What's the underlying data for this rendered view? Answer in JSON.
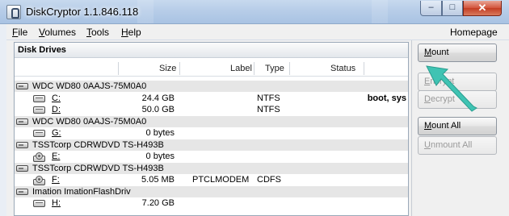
{
  "window": {
    "title": "DiskCryptor 1.1.846.118",
    "minimize_glyph": "–",
    "maximize_glyph": "□",
    "close_glyph": "✕"
  },
  "menu": {
    "file": {
      "u": "F",
      "rest": "ile"
    },
    "volumes": {
      "u": "V",
      "rest": "olumes"
    },
    "tools": {
      "u": "T",
      "rest": "ools"
    },
    "help": {
      "u": "H",
      "rest": "elp"
    },
    "homepage": "Homepage"
  },
  "panel": {
    "title": "Disk Drives",
    "columns": {
      "size": "Size",
      "label": "Label",
      "type": "Type",
      "status": "Status"
    }
  },
  "rows": [
    {
      "kind": "disk",
      "name": "WDC WD80 0AAJS-75M0A0"
    },
    {
      "kind": "volume",
      "letter": "C:",
      "size": "24.4 GB",
      "label": "",
      "type": "NTFS",
      "status": "boot, sys"
    },
    {
      "kind": "volume",
      "letter": "D:",
      "size": "50.0 GB",
      "label": "",
      "type": "NTFS",
      "status": ""
    },
    {
      "kind": "disk",
      "name": "WDC WD80 0AAJS-75M0A0"
    },
    {
      "kind": "volume",
      "letter": "G:",
      "size": "0 bytes",
      "label": "",
      "type": "",
      "status": ""
    },
    {
      "kind": "disk",
      "name": "TSSTcorp CDRWDVD TS-H493B"
    },
    {
      "kind": "cd",
      "letter": "E:",
      "size": "0 bytes",
      "label": "",
      "type": "",
      "status": ""
    },
    {
      "kind": "disk",
      "name": "TSSTcorp CDRWDVD TS-H493B"
    },
    {
      "kind": "cd",
      "letter": "F:",
      "size": "5.05 MB",
      "label": "PTCLMODEM",
      "type": "CDFS",
      "status": ""
    },
    {
      "kind": "disk",
      "name": "Imation ImationFlashDriv"
    },
    {
      "kind": "volume",
      "letter": "H:",
      "size": "7.20 GB",
      "label": "",
      "type": "",
      "status": ""
    }
  ],
  "buttons": {
    "mount": {
      "u": "M",
      "rest": "ount"
    },
    "encrypt": {
      "u": "E",
      "rest": "ncrypt"
    },
    "decrypt": {
      "u": "D",
      "rest": "ecrypt"
    },
    "mount_all": {
      "u": "M",
      "rest": "ount All"
    },
    "unmount_all": {
      "u": "U",
      "rest": "nmount All"
    }
  },
  "colors": {
    "annotation_arrow": "#3fc3b3",
    "disk_row_bg": "#e6e6e6"
  }
}
